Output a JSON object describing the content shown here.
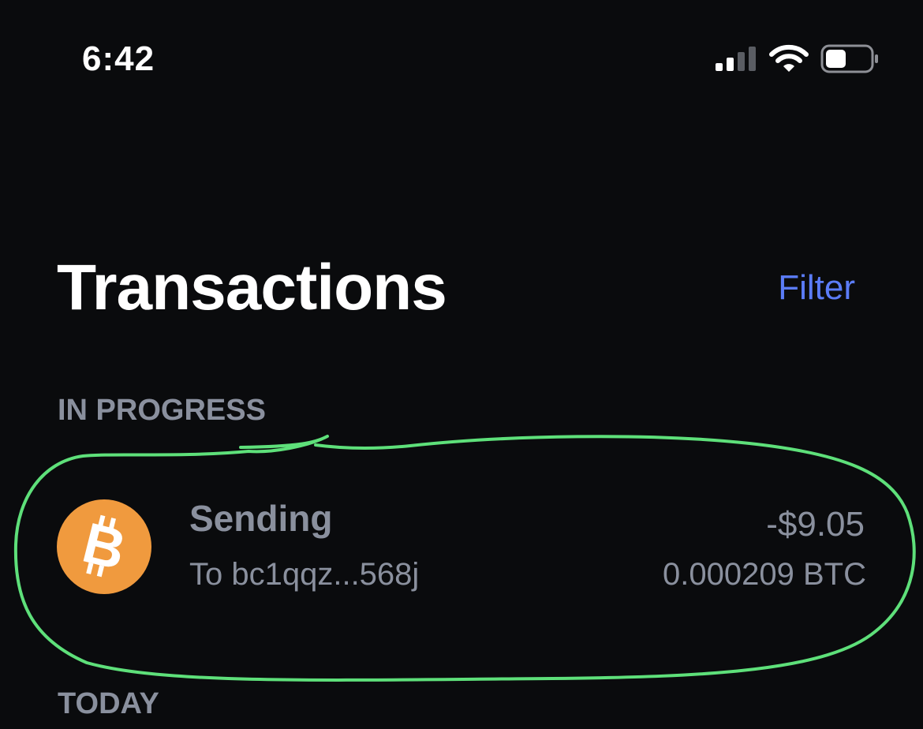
{
  "status_bar": {
    "time": "6:42",
    "icons": [
      "signal-icon",
      "wifi-icon",
      "battery-icon"
    ],
    "battery_level": 0.4
  },
  "header": {
    "title": "Transactions",
    "filter_label": "Filter"
  },
  "sections": {
    "in_progress_label": "IN PROGRESS",
    "today_label": "TODAY"
  },
  "transaction": {
    "icon": "bitcoin-icon",
    "title": "Sending",
    "subtitle": "To bc1qqz...568j",
    "amount": "-$9.05",
    "crypto_amount": "0.000209 BTC"
  },
  "colors": {
    "background": "#0a0b0d",
    "accent": "#5b7cf7",
    "muted_text": "#8a909e",
    "bitcoin": "#f09a3e",
    "annotation": "#5ee07a"
  }
}
